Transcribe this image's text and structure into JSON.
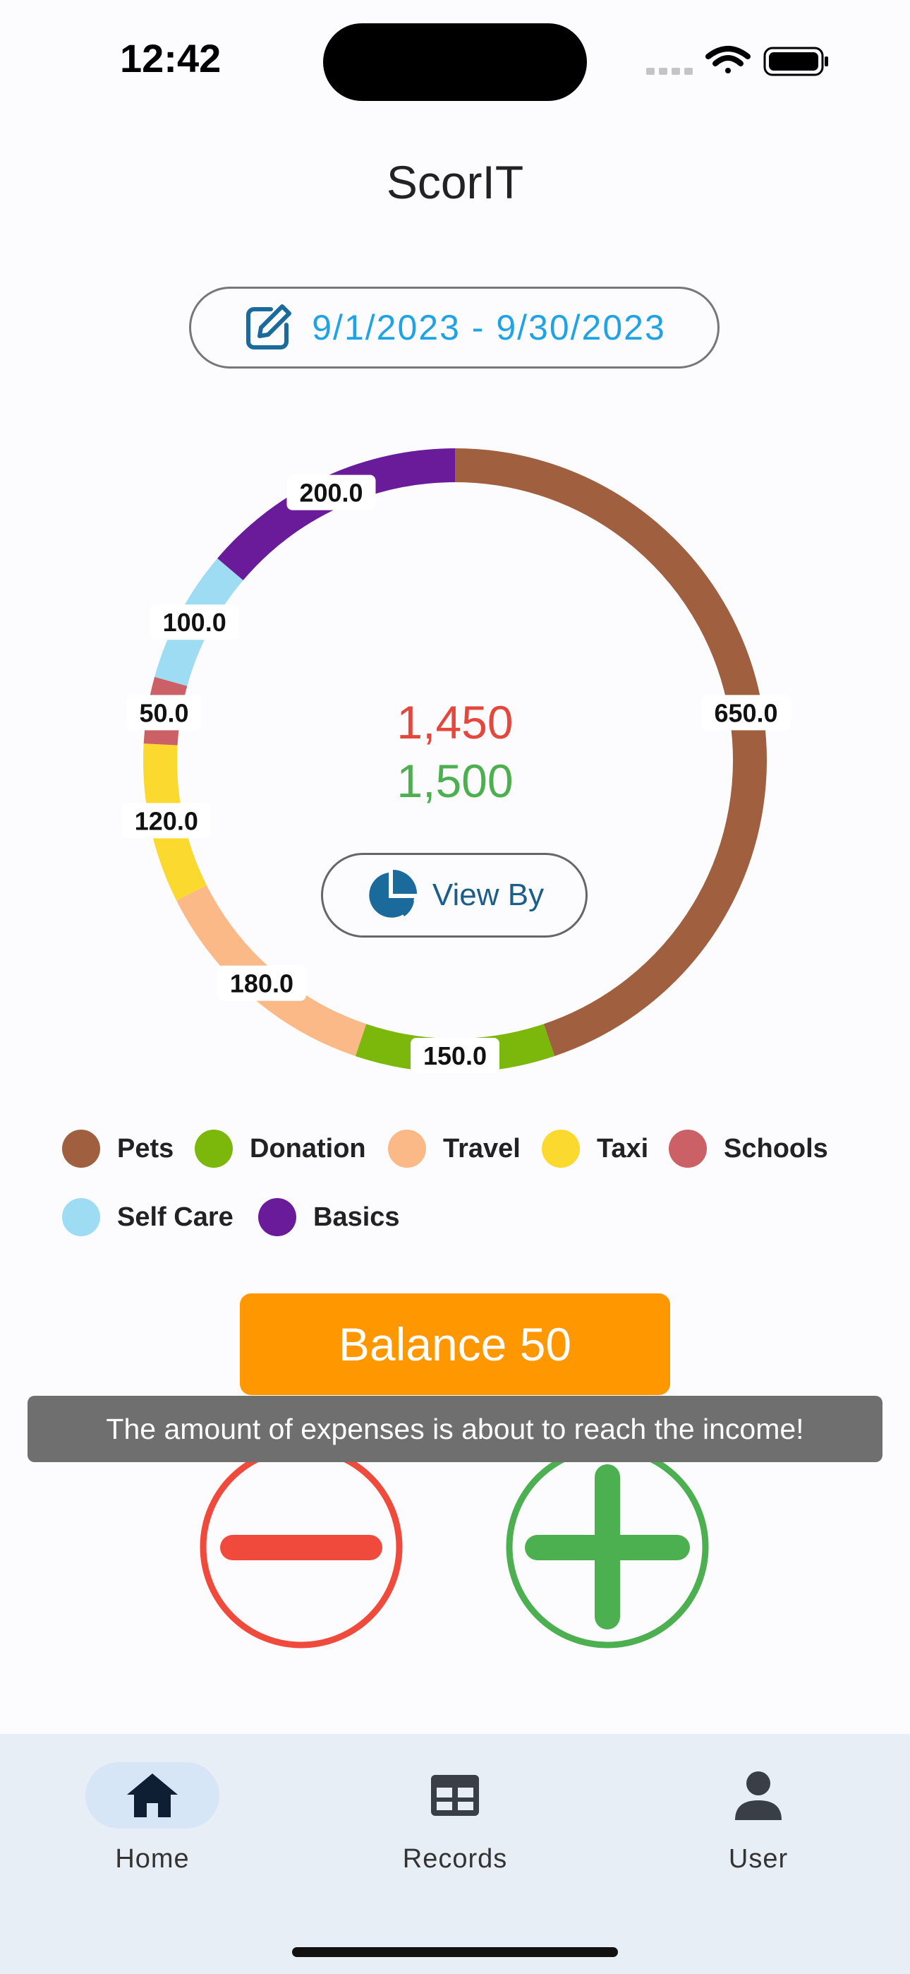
{
  "status_bar": {
    "time": "12:42"
  },
  "app": {
    "title": "ScorIT"
  },
  "date_range": {
    "label": "9/1/2023 - 9/30/2023",
    "icon": "edit-icon"
  },
  "summary": {
    "expenses": "1,450",
    "income": "1,500"
  },
  "view_by": {
    "label": "View By",
    "icon": "pie-chart-icon"
  },
  "chart_data": {
    "type": "pie",
    "style": "donut",
    "categories": [
      "Pets",
      "Donation",
      "Travel",
      "Taxi",
      "Schools",
      "Self Care",
      "Basics"
    ],
    "values": [
      650,
      150,
      180,
      120,
      50,
      100,
      200
    ],
    "data_labels": [
      "650.0",
      "150.0",
      "180.0",
      "120.0",
      "50.0",
      "100.0",
      "200.0"
    ],
    "colors": [
      "#a0603f",
      "#7cb70b",
      "#fbb987",
      "#fcd92f",
      "#cb6167",
      "#9ddcf2",
      "#6a1b9a"
    ],
    "legend_placement": "bottom"
  },
  "balance": {
    "label": "Balance 50"
  },
  "toast": {
    "message": "The amount of expenses is about to reach the income!"
  },
  "actions": {
    "subtract_icon": "minus-circle-icon",
    "add_icon": "plus-circle-icon"
  },
  "nav": {
    "items": [
      {
        "label": "Home",
        "icon": "home-icon",
        "active": true
      },
      {
        "label": "Records",
        "icon": "table-icon",
        "active": false
      },
      {
        "label": "User",
        "icon": "user-icon",
        "active": false
      }
    ]
  },
  "colors": {
    "accent_blue": "#1fa3e4",
    "expense_red": "#e4473c",
    "income_green": "#4caf50",
    "balance_orange": "#ff9800"
  }
}
